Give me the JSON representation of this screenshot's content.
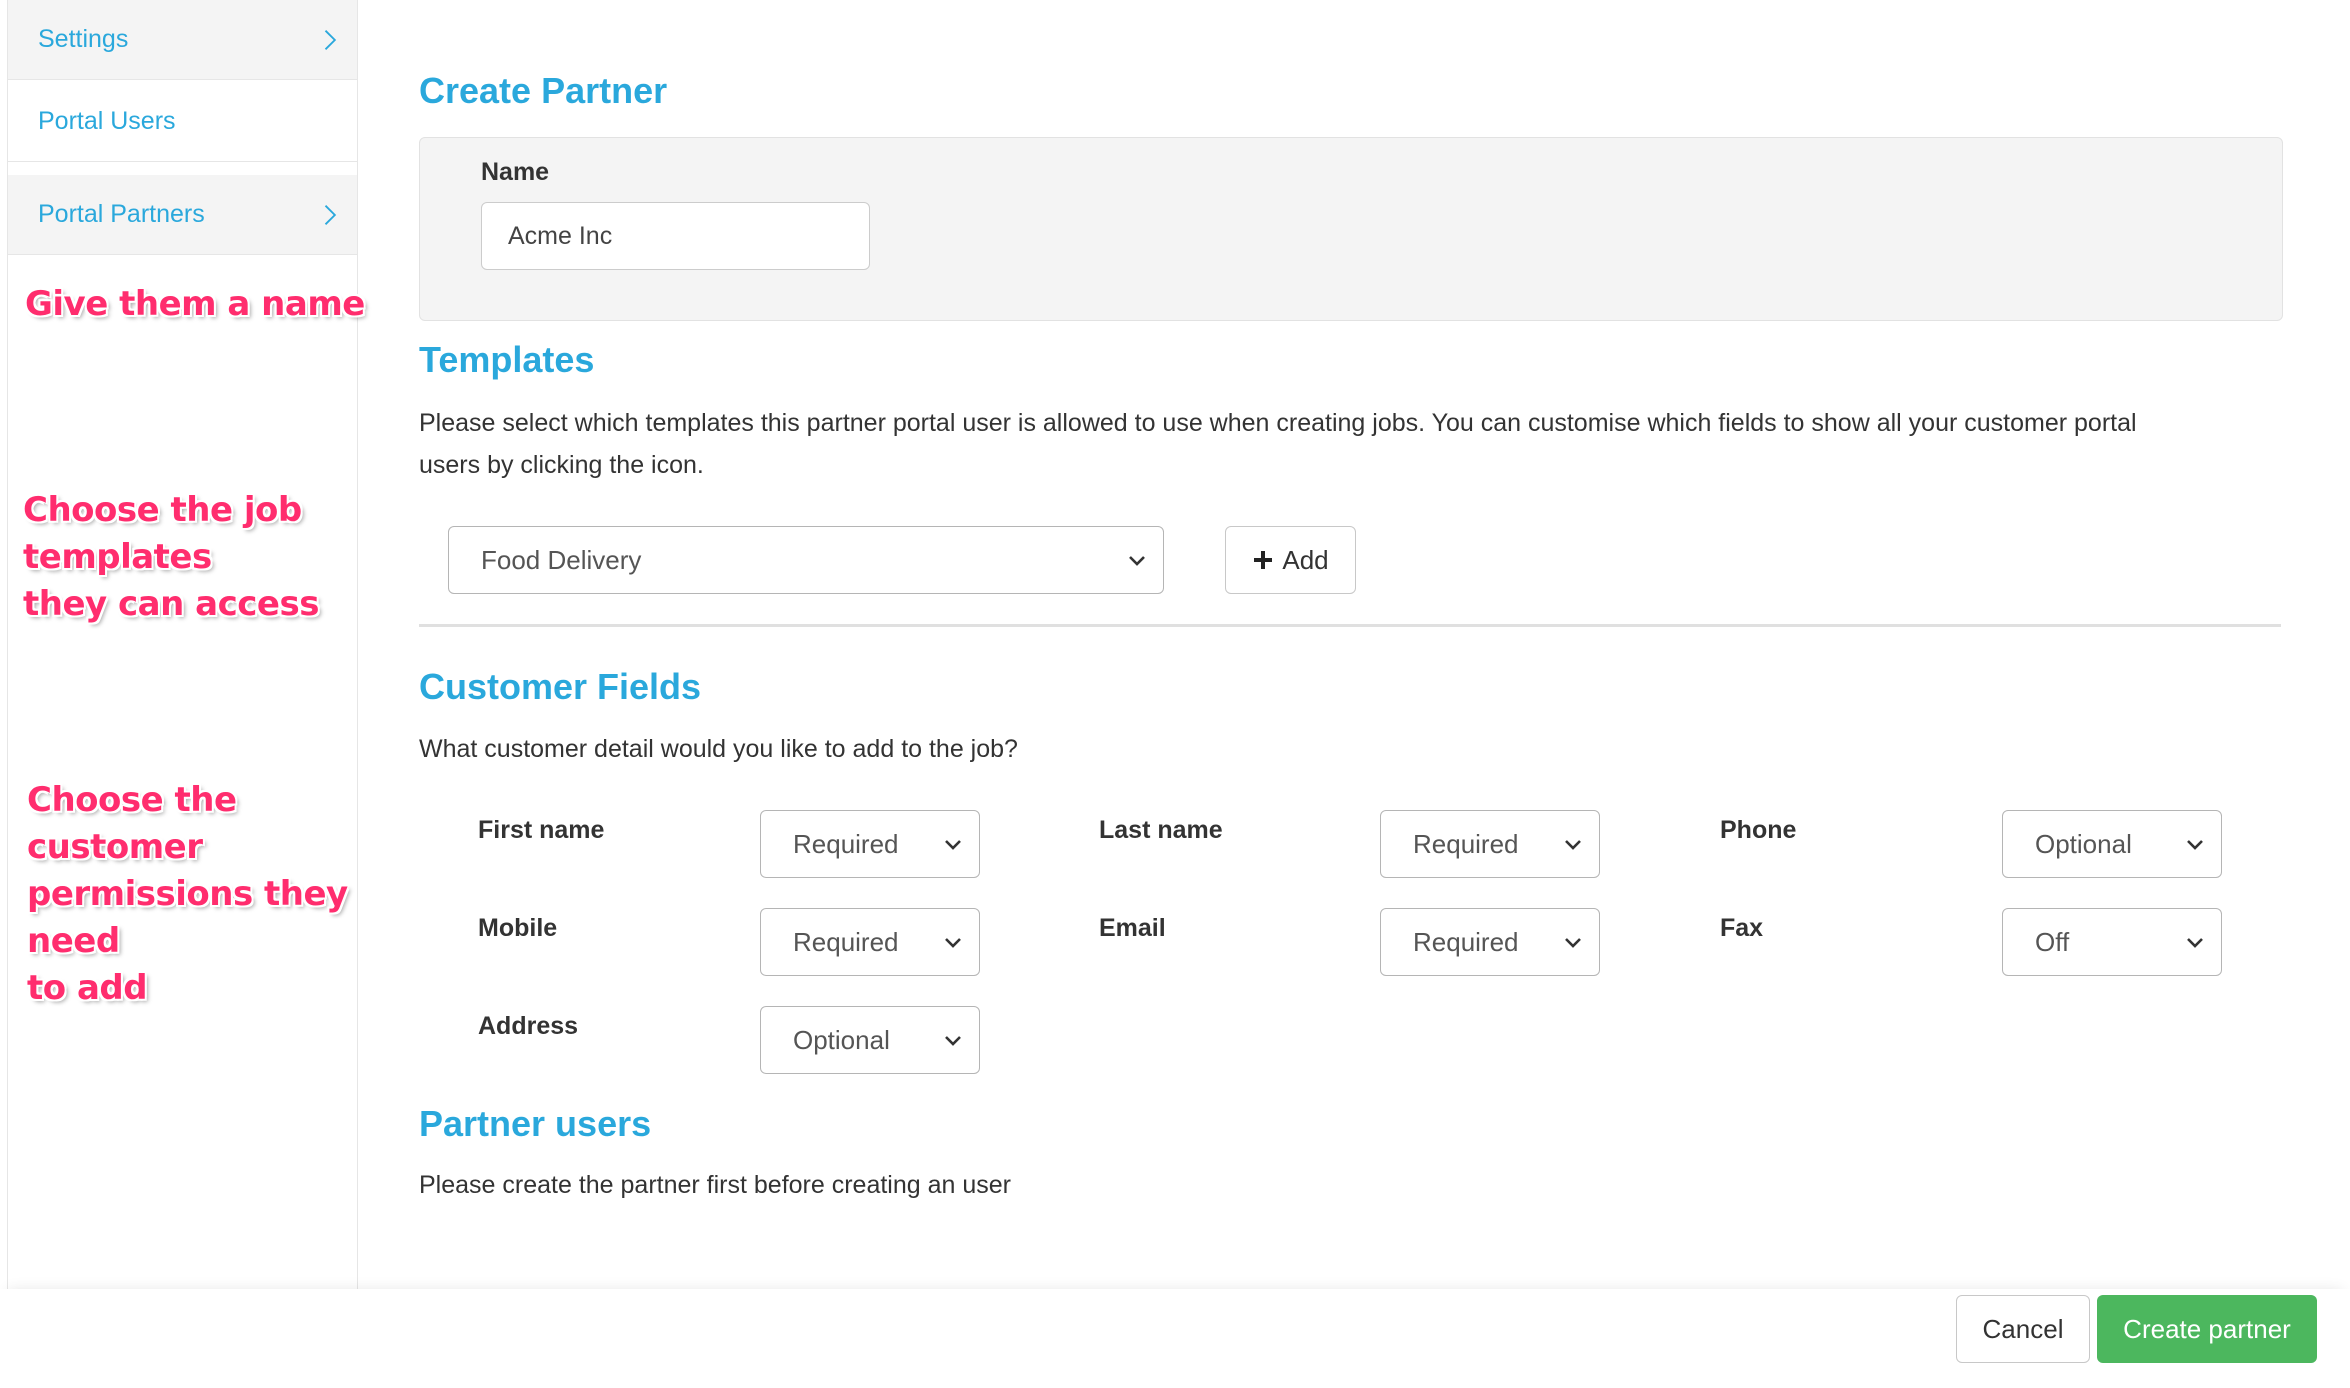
{
  "sidebar": {
    "items": [
      {
        "label": "Settings"
      },
      {
        "label": "Portal Users"
      },
      {
        "label": "Portal Partners"
      }
    ]
  },
  "annotations": {
    "name_hint": "Give them a name",
    "templates_hint": [
      "Choose the job",
      "templates",
      "they can access"
    ],
    "customer_hint": [
      "Choose the",
      "customer",
      "permissions they",
      "need",
      "to add"
    ]
  },
  "create_partner": {
    "title": "Create Partner",
    "name_label": "Name",
    "name_value": "Acme Inc"
  },
  "templates": {
    "title": "Templates",
    "description_line1": "Please select which templates this partner portal user is allowed to use when creating jobs. You can customise which fields to show all your customer portal",
    "description_line2": "users by clicking the icon.",
    "selected_template": "Food Delivery",
    "add_label": "Add"
  },
  "customer_fields": {
    "title": "Customer Fields",
    "description": "What customer detail would you like to add to the job?",
    "fields": [
      {
        "label": "First name",
        "value": "Required"
      },
      {
        "label": "Last name",
        "value": "Required"
      },
      {
        "label": "Phone",
        "value": "Optional"
      },
      {
        "label": "Mobile",
        "value": "Required"
      },
      {
        "label": "Email",
        "value": "Required"
      },
      {
        "label": "Fax",
        "value": "Off"
      },
      {
        "label": "Address",
        "value": "Optional"
      }
    ]
  },
  "partner_users": {
    "title": "Partner users",
    "description": "Please create the partner first before creating an user"
  },
  "footer": {
    "cancel_label": "Cancel",
    "create_label": "Create partner"
  },
  "colors": {
    "accent": "#2aa8dc",
    "annotation": "#ff2d6e",
    "primary_button": "#4cb75e"
  }
}
